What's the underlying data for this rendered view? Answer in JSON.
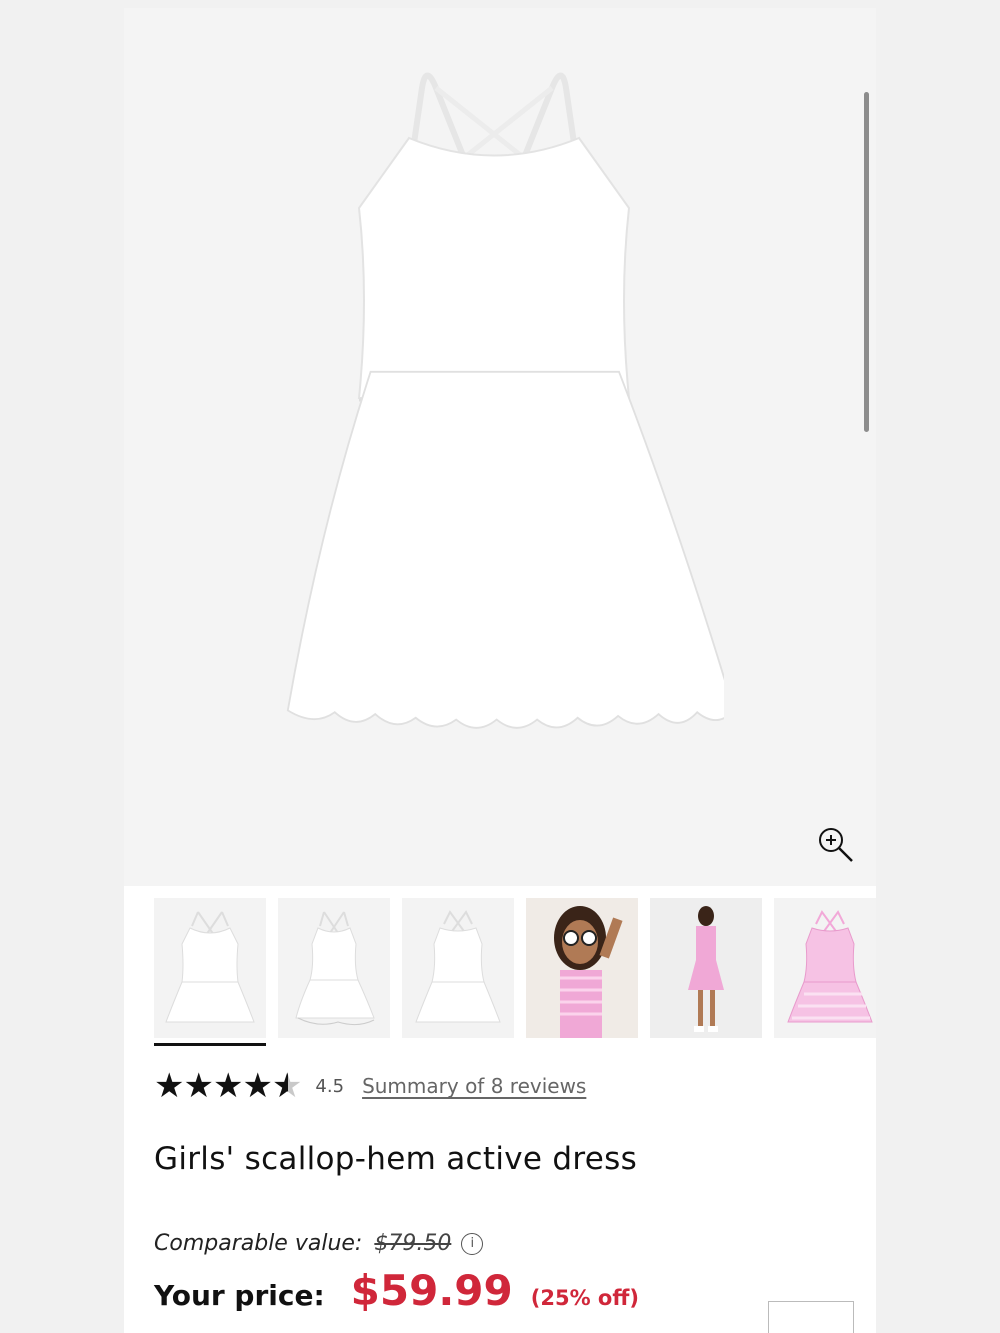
{
  "product": {
    "title": "Girls' scallop-hem active dress",
    "main_image": "white scallop-hem active dress",
    "zoom_icon": "zoom-in-icon"
  },
  "thumbnails": [
    {
      "label": "white dress front",
      "active": true
    },
    {
      "label": "white dress with shorts",
      "active": false
    },
    {
      "label": "white dress back",
      "active": false
    },
    {
      "label": "girl in pink gingham dress with sunglasses",
      "active": false
    },
    {
      "label": "girl in pink gingham dress back view",
      "active": false
    },
    {
      "label": "pink gingham dress back",
      "active": false
    }
  ],
  "rating": {
    "stars": 4.5,
    "max": 5,
    "value_text": "4.5",
    "reviews_link": "Summary of 8 reviews"
  },
  "pricing": {
    "comparable_label": "Comparable value:",
    "comparable_price": "$79.50",
    "your_price_label": "Your price:",
    "your_price": "$59.99",
    "discount": "(25% off)",
    "info_icon": "info-icon"
  },
  "colors": {
    "price_red": "#d0273a",
    "text": "#111111"
  }
}
